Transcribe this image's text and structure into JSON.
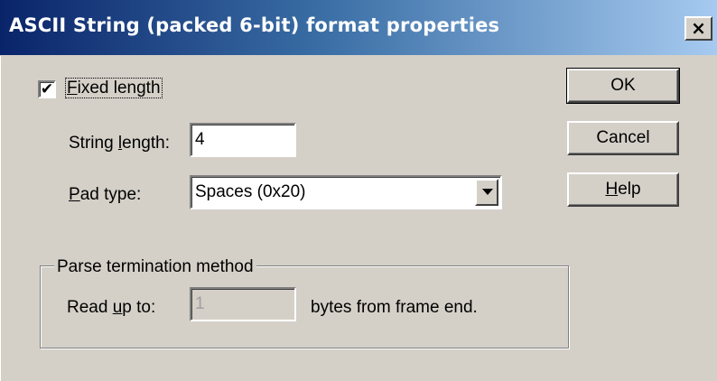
{
  "window": {
    "title": "ASCII String (packed 6-bit) format properties",
    "close_glyph": "×"
  },
  "fixed_length": {
    "checked": true,
    "check_glyph": "✔",
    "label_pre": "",
    "label_mnemonic": "F",
    "label_post": "ixed length"
  },
  "string_length": {
    "label_pre": "String ",
    "label_mnemonic": "l",
    "label_post": "ength:",
    "value": "4"
  },
  "pad_type": {
    "label_pre": "",
    "label_mnemonic": "P",
    "label_post": "ad type:",
    "selected": "Spaces (0x20)"
  },
  "parse_termination": {
    "group_label": "Parse termination method",
    "read_label_pre": "Read ",
    "read_label_mnemonic": "u",
    "read_label_post": "p to:",
    "value": "1",
    "suffix": "bytes from frame end."
  },
  "buttons": {
    "ok": "OK",
    "cancel": "Cancel",
    "help_mnemonic": "H",
    "help_post": "elp"
  },
  "colors": {
    "titlebar_start": "#0a246a",
    "titlebar_end": "#a6caf0",
    "face": "#d4d0c8"
  }
}
